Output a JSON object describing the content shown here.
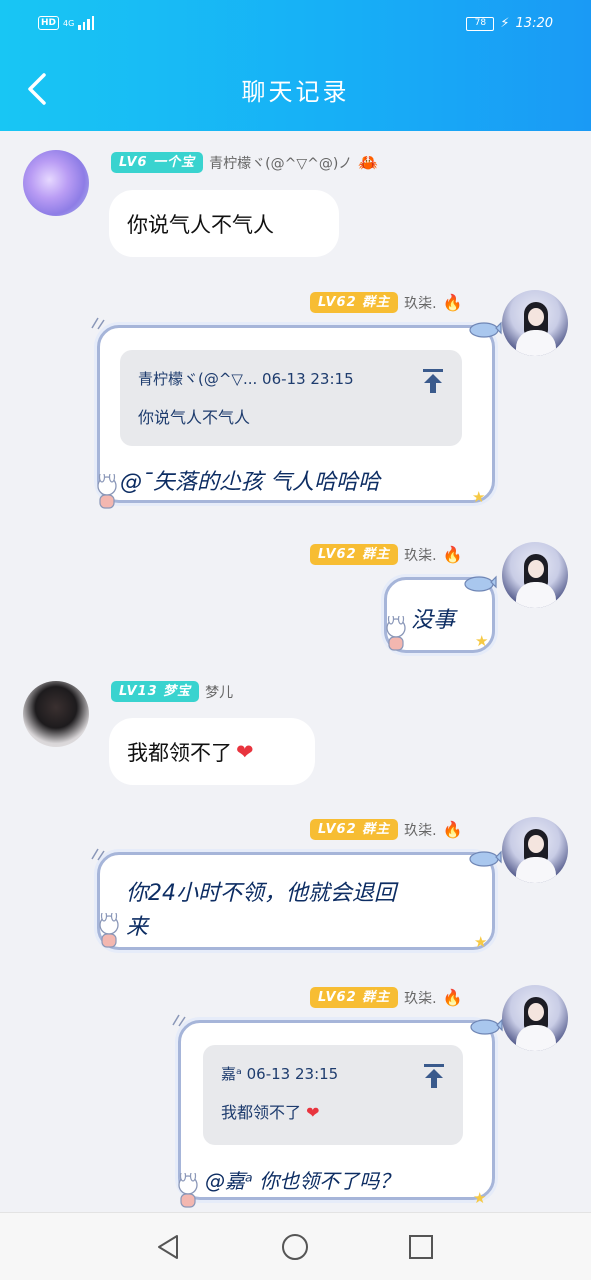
{
  "status_bar": {
    "hd": "HD",
    "network": "4G",
    "battery": "78",
    "time": "13:20"
  },
  "header": {
    "title": "聊天记录"
  },
  "messages": [
    {
      "tag": "LV6 一个宝",
      "name": "青柠檬ヾ(@^▽^@)ノ",
      "text": "你说气人不气人"
    },
    {
      "tag": "LV62 群主",
      "name": "玖柒.",
      "quote_header": "青柠檬ヾ(@^▽... 06-13 23:15",
      "quote_text": "你说气人不气人",
      "text": "@ˉ矢落的尐孩 气人哈哈哈"
    },
    {
      "tag": "LV62 群主",
      "name": "玖柒.",
      "text": "没事"
    },
    {
      "tag": "LV13 梦宝",
      "name": "梦儿",
      "text": "我都领不了",
      "emoji": "❤"
    },
    {
      "tag": "LV62 群主",
      "name": "玖柒.",
      "text_line1": "你24小时不领，他就会退回",
      "text_line2": "来"
    },
    {
      "tag": "LV62 群主",
      "name": "玖柒.",
      "quote_header": "嘉ᵃ 06-13 23:15",
      "quote_text": "我都领不了",
      "quote_emoji": "❤",
      "text": "@嘉ᵃ 你也领不了吗？"
    }
  ],
  "icons": {
    "back": "chevron-left-icon",
    "fire": "🔥",
    "crab": "🦀"
  },
  "colors": {
    "header": "#17aef6",
    "tag_teal": "#39d3cf",
    "tag_gold": "#f7bd33",
    "heart": "#e8343e"
  }
}
